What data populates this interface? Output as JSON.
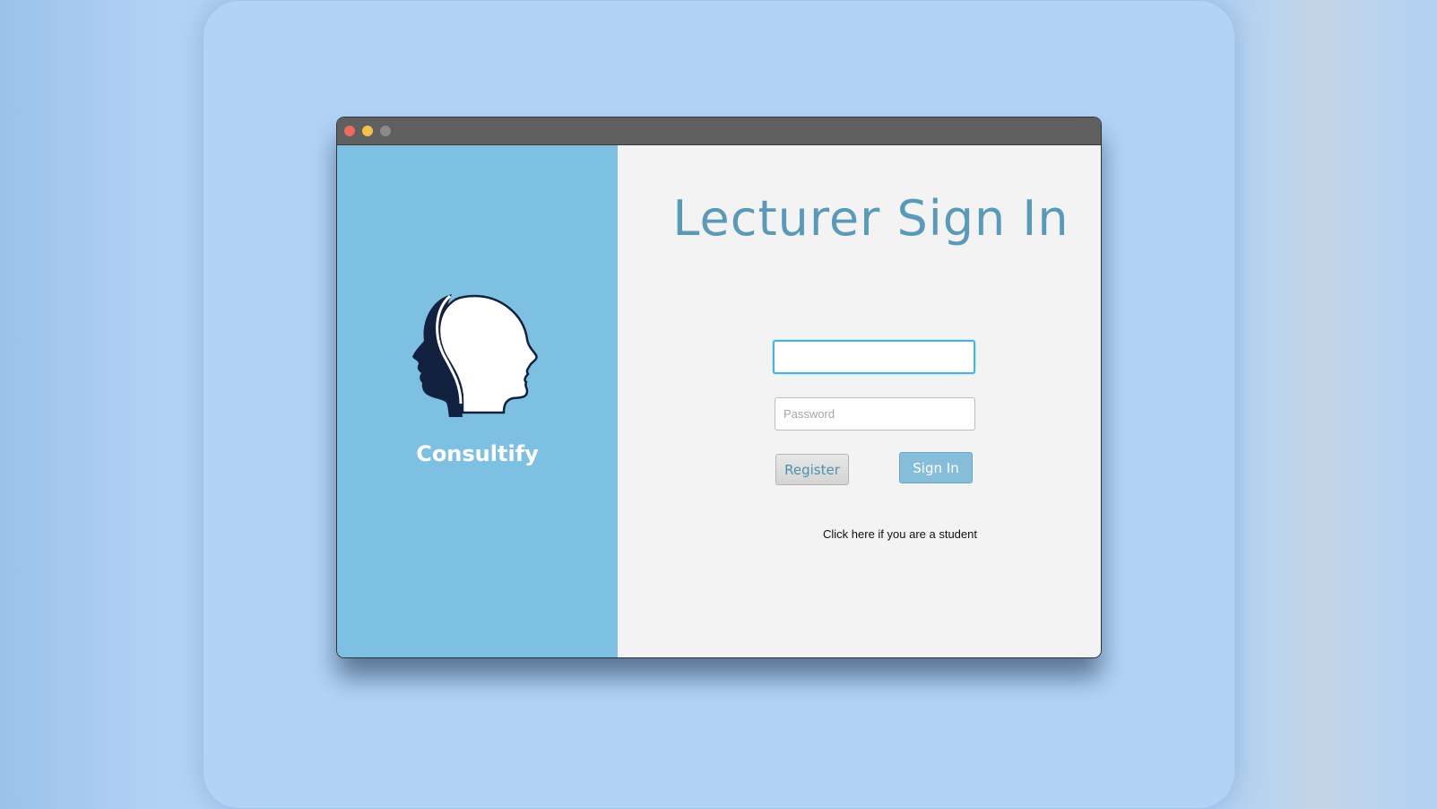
{
  "window": {
    "controls": [
      "close",
      "minimize",
      "maximize"
    ]
  },
  "sidebar": {
    "logo_icon": "two-heads-profile-icon",
    "brand_name": "Consultify"
  },
  "main": {
    "heading": "Lecturer Sign In",
    "username_value": "",
    "username_placeholder": "",
    "password_placeholder": "Password",
    "register_label": "Register",
    "signin_label": "Sign In",
    "student_link": "Click here if you are a student"
  },
  "colors": {
    "background": "#b2d2f4",
    "sidebar": "#7ec0e1",
    "heading": "#5a9ab8",
    "titlebar": "#5f5f5f",
    "logo_dark": "#12213f"
  }
}
